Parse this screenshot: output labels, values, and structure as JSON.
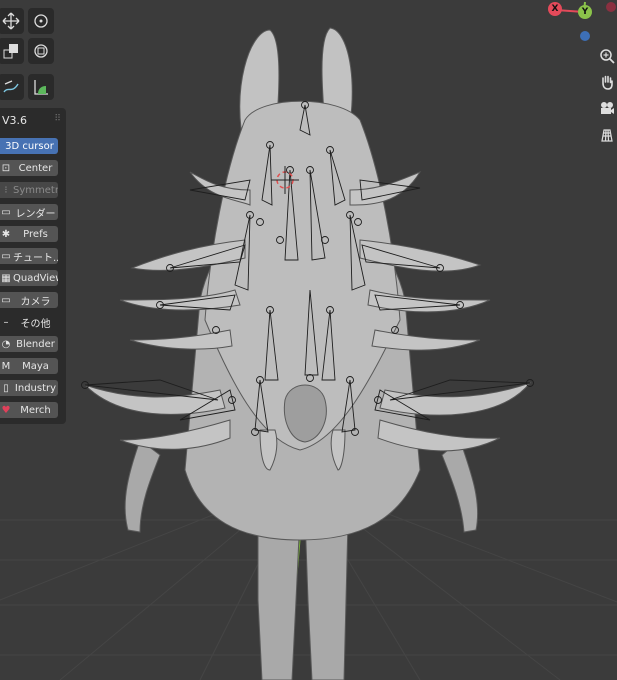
{
  "addon": {
    "version": "V3.6",
    "buttons": [
      {
        "icon": "",
        "label": "3D cursor",
        "state": "active"
      },
      {
        "icon": "⊡",
        "label": "Center",
        "state": "normal"
      },
      {
        "icon": "⁝",
        "label": "Symmetry",
        "state": "disabled"
      },
      {
        "icon": "▭",
        "label": "レンダー",
        "state": "normal"
      },
      {
        "icon": "✱",
        "label": "Prefs",
        "state": "normal"
      },
      {
        "icon": "▭",
        "label": "チュート...",
        "state": "normal"
      },
      {
        "icon": "▦",
        "label": "QuadView",
        "state": "normal"
      },
      {
        "icon": "▭",
        "label": "カメラ",
        "state": "normal"
      },
      {
        "icon": "–",
        "label": "その他",
        "state": "plain"
      },
      {
        "icon": "◔",
        "label": "Blender",
        "state": "normal"
      },
      {
        "icon": "M",
        "label": "Maya",
        "state": "normal"
      },
      {
        "icon": "▯",
        "label": "Industry",
        "state": "normal"
      },
      {
        "icon": "♥",
        "label": "Merch",
        "state": "normal"
      }
    ]
  },
  "gizmo": {
    "x_label": "X",
    "y_label": "Y",
    "colors": {
      "x": "#e44a5a",
      "y": "#8bc34a",
      "z": "#3d6fb6"
    }
  },
  "icons": {
    "zoom": "zoom-icon",
    "pan": "hand-pan-icon",
    "camera": "camera-view-icon",
    "grid": "ortho-grid-icon"
  }
}
